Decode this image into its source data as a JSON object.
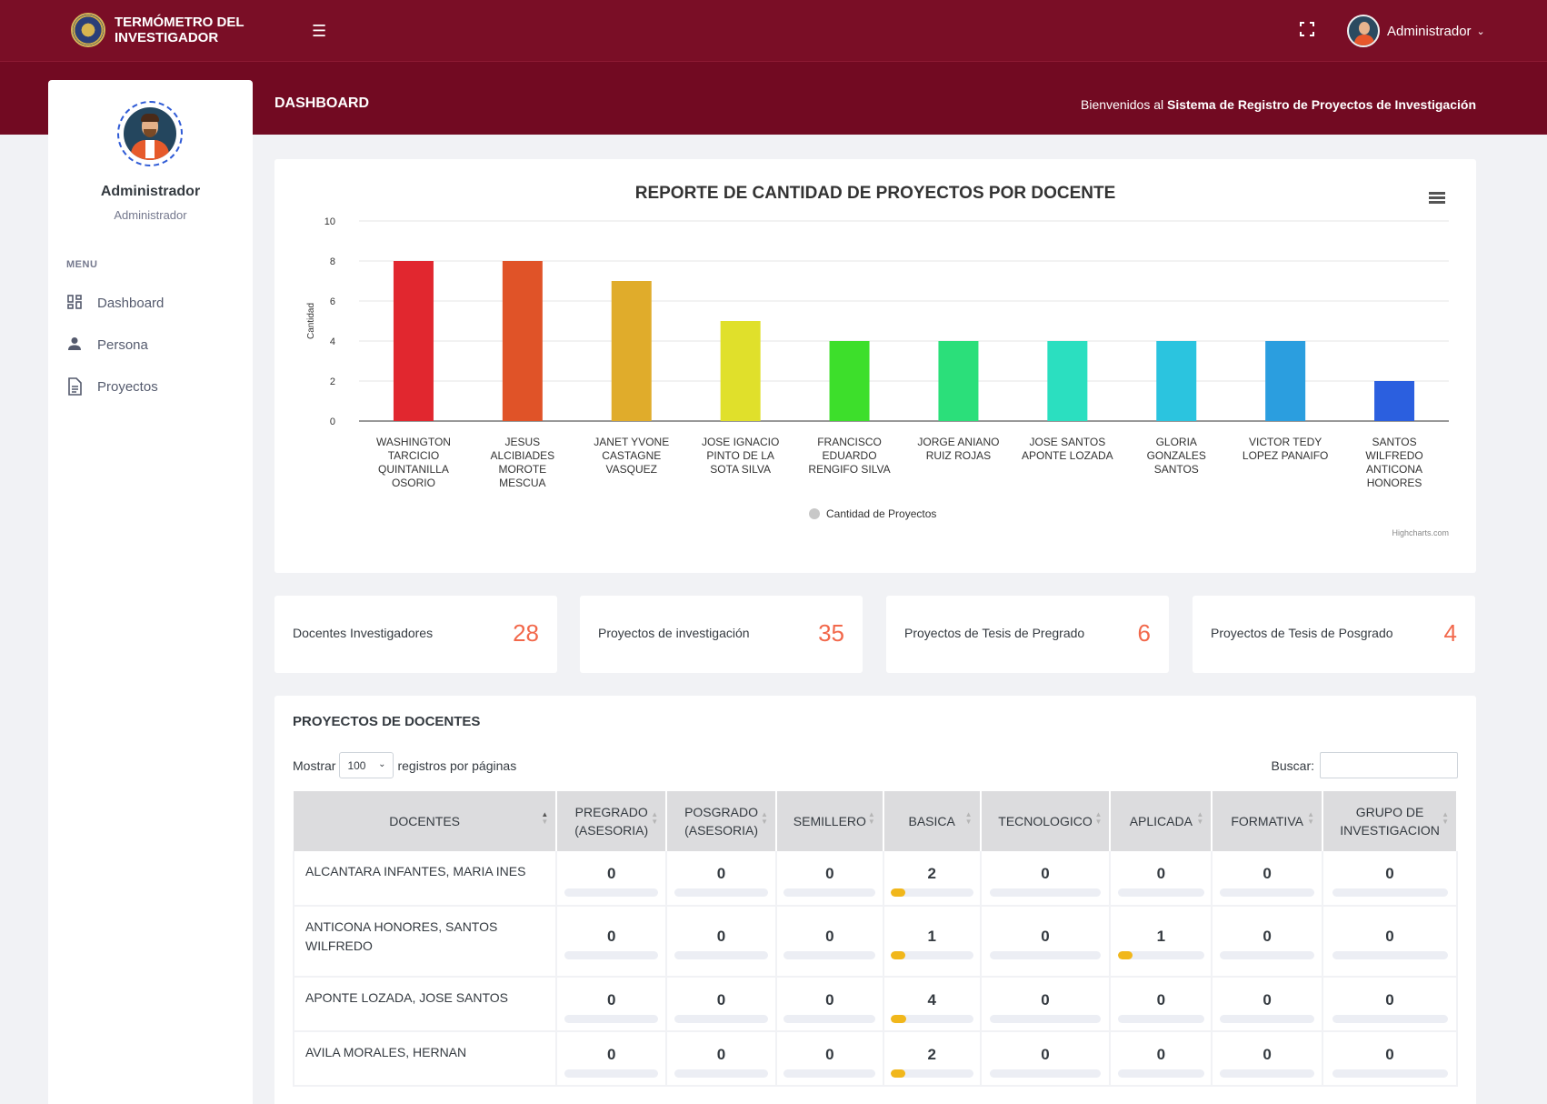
{
  "app": {
    "brand_line1": "TERMÓMETRO DEL",
    "brand_line2": "INVESTIGADOR",
    "user_name": "Administrador"
  },
  "header": {
    "page_title": "DASHBOARD",
    "welcome_prefix": "Bienvenidos al ",
    "welcome_system": "Sistema de Registro de Proyectos de Investigación"
  },
  "sidebar": {
    "profile_name": "Administrador",
    "profile_role": "Administrador",
    "menu_title": "MENU",
    "items": [
      {
        "label": "Dashboard",
        "icon": "dashboard-icon"
      },
      {
        "label": "Persona",
        "icon": "person-icon"
      },
      {
        "label": "Proyectos",
        "icon": "document-icon"
      }
    ]
  },
  "stats": [
    {
      "label": "Docentes Investigadores",
      "value": "28"
    },
    {
      "label": "Proyectos de investigación",
      "value": "35"
    },
    {
      "label": "Proyectos de Tesis de Pregrado",
      "value": "6"
    },
    {
      "label": "Proyectos de Tesis de Posgrado",
      "value": "4"
    }
  ],
  "chart_data": {
    "type": "bar",
    "title": "REPORTE DE CANTIDAD DE PROYECTOS POR DOCENTE",
    "ylabel": "Cantidad",
    "ylim": [
      0,
      10
    ],
    "yticks": [
      0,
      2,
      4,
      6,
      8,
      10
    ],
    "grid": true,
    "legend": "bottom-center",
    "credits": "Highcharts.com",
    "series": [
      {
        "name": "Cantidad de Proyectos",
        "values": [
          8,
          8,
          7,
          5,
          4,
          4,
          4,
          4,
          4,
          2
        ]
      }
    ],
    "categories": [
      [
        "WASHINGTON",
        "TARCICIO",
        "QUINTANILLA",
        "OSORIO"
      ],
      [
        "JESUS",
        "ALCIBIADES",
        "MOROTE",
        "MESCUA"
      ],
      [
        "JANET YVONE",
        "CASTAGNE",
        "VASQUEZ"
      ],
      [
        "JOSE IGNACIO",
        "PINTO DE LA",
        "SOTA SILVA"
      ],
      [
        "FRANCISCO",
        "EDUARDO",
        "RENGIFO SILVA"
      ],
      [
        "JORGE ANIANO",
        "RUIZ ROJAS"
      ],
      [
        "JOSE SANTOS",
        "APONTE LOZADA"
      ],
      [
        "GLORIA",
        "GONZALES",
        "SANTOS"
      ],
      [
        "VICTOR TEDY",
        "LOPEZ PANAIFO"
      ],
      [
        "SANTOS",
        "WILFREDO",
        "ANTICONA",
        "HONORES"
      ]
    ],
    "colors": [
      "#e1272f",
      "#e05328",
      "#e0ac2b",
      "#e0e02b",
      "#3ddf2b",
      "#2bdf7a",
      "#2bdfc0",
      "#2bc4df",
      "#2b9edf",
      "#2b5fdf"
    ]
  },
  "table": {
    "title": "PROYECTOS DE DOCENTES",
    "show_label": "Mostrar",
    "page_size": "100",
    "per_page_label": "registros por páginas",
    "search_label": "Buscar:",
    "search_value": "",
    "max_value": 8,
    "columns": [
      [
        "DOCENTES"
      ],
      [
        "PREGRADO",
        "(ASESORIA)"
      ],
      [
        "POSGRADO",
        "(ASESORIA)"
      ],
      [
        "SEMILLERO"
      ],
      [
        "BASICA"
      ],
      [
        "TECNOLOGICO"
      ],
      [
        "APLICADA"
      ],
      [
        "FORMATIVA"
      ],
      [
        "GRUPO DE",
        "INVESTIGACION"
      ]
    ],
    "rows": [
      {
        "name": "ALCANTARA INFANTES, MARIA INES",
        "values": [
          0,
          0,
          0,
          2,
          0,
          0,
          0,
          0
        ]
      },
      {
        "name": "ANTICONA HONORES, SANTOS WILFREDO",
        "values": [
          0,
          0,
          0,
          1,
          0,
          1,
          0,
          0
        ]
      },
      {
        "name": "APONTE LOZADA, JOSE SANTOS",
        "values": [
          0,
          0,
          0,
          4,
          0,
          0,
          0,
          0
        ]
      },
      {
        "name": "AVILA MORALES, HERNAN",
        "values": [
          0,
          0,
          0,
          2,
          0,
          0,
          0,
          0
        ]
      }
    ]
  }
}
